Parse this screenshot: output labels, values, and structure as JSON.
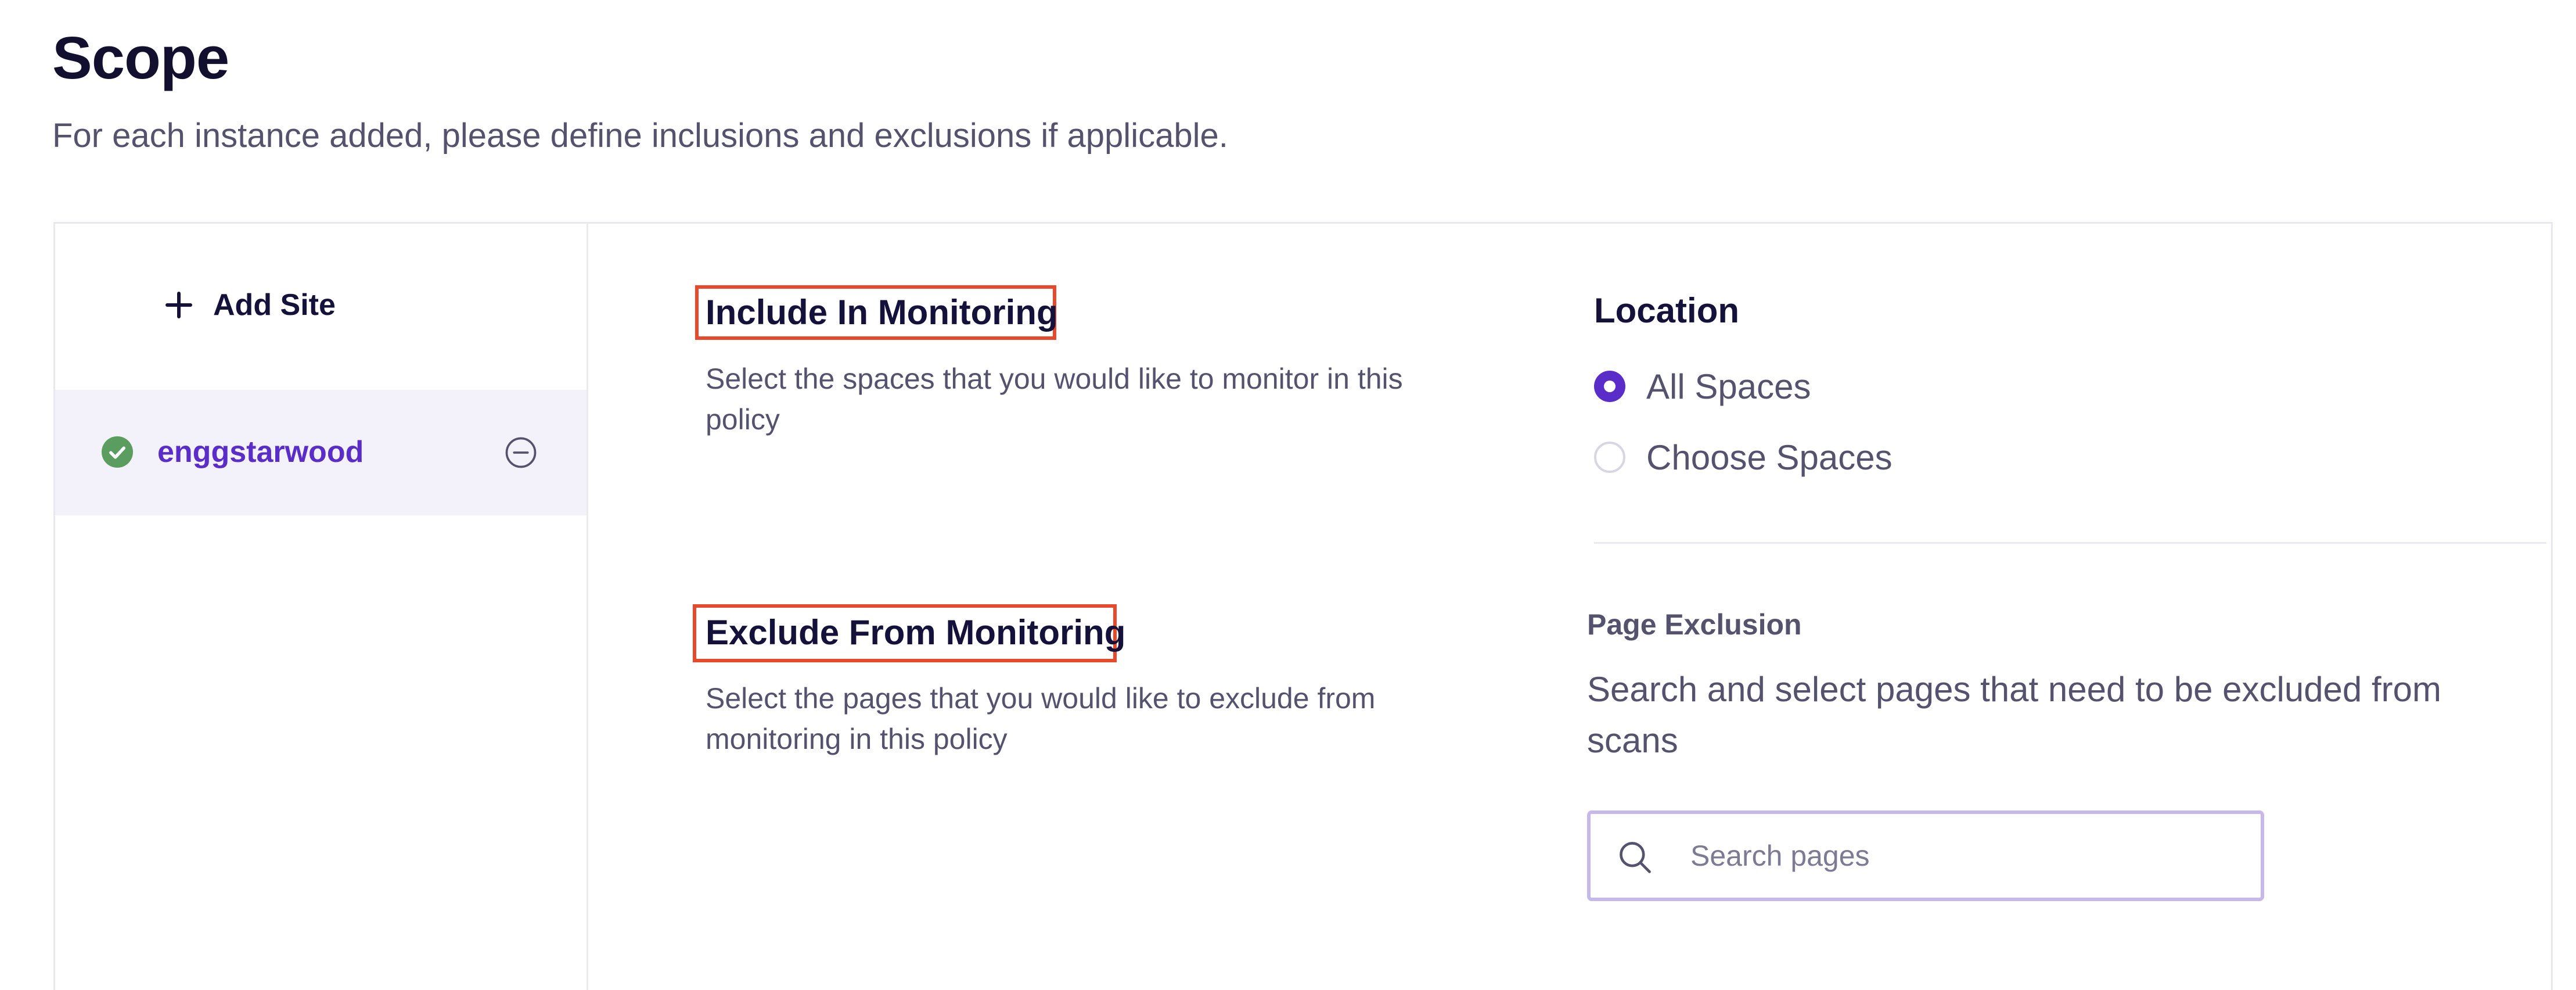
{
  "page": {
    "title": "Scope",
    "subtitle": "For each instance added, please define inclusions and exclusions if applicable."
  },
  "sidebar": {
    "add_site_label": "Add Site",
    "sites": [
      {
        "name": "enggstarwood",
        "status": "connected"
      }
    ]
  },
  "include": {
    "title": "Include In Monitoring",
    "description": "Select the spaces that you would like to monitor in this policy"
  },
  "exclude": {
    "title": "Exclude From Monitoring",
    "description": "Select the pages that you would like to exclude from monitoring in this policy"
  },
  "location": {
    "title": "Location",
    "options": [
      {
        "label": "All Spaces",
        "selected": true
      },
      {
        "label": "Choose Spaces",
        "selected": false
      }
    ]
  },
  "page_exclusion": {
    "title": "Page Exclusion",
    "description": "Search and select pages that need to be excluded from scans",
    "search_placeholder": "Search pages"
  },
  "colors": {
    "accent": "#5b2dc8",
    "success": "#5a9d5f",
    "highlight": "#e8492a",
    "text_primary": "#14123a",
    "text_secondary": "#55526e"
  },
  "icons": {
    "add": "plus-icon",
    "site_status": "check-circle-icon",
    "remove_site": "minus-circle-icon",
    "search": "search-icon"
  }
}
